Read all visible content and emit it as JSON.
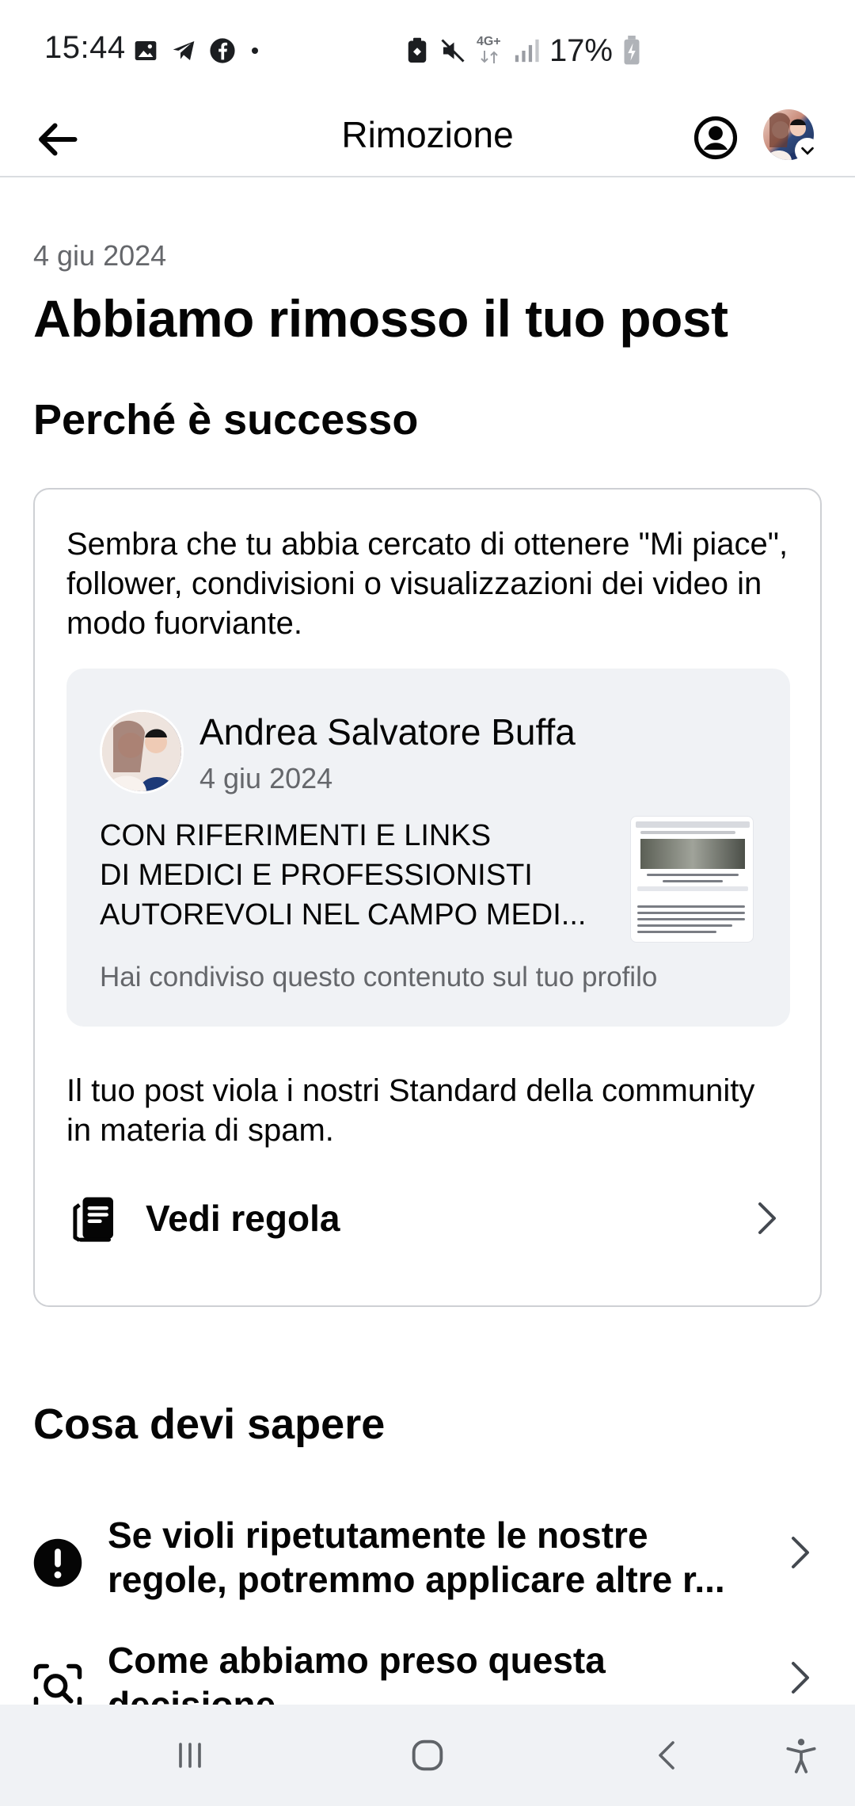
{
  "status_bar": {
    "time": "15:44",
    "left_icons": [
      "image-icon",
      "telegram-icon",
      "facebook-icon",
      "dot-icon"
    ],
    "right_icons": [
      "vpn-icon",
      "mute-icon",
      "network-4g-icon",
      "signal-icon"
    ],
    "network_label": "4G+",
    "battery_percent": "17%"
  },
  "app_bar": {
    "title": "Rimozione"
  },
  "page": {
    "date": "4 giu 2024",
    "headline": "Abbiamo rimosso il tuo post",
    "why_title": "Perché è successo",
    "reason": "Sembra che tu abbia cercato di ottenere \"Mi piace\", follower, condivisioni o visualizzazioni dei video in modo fuorviante.",
    "post": {
      "author": "Andrea Salvatore Buffa",
      "date": "4 giu 2024",
      "text_lines": [
        "CON RIFERIMENTI E LINKS",
        "DI MEDICI E PROFESSIONISTI",
        "AUTOREVOLI NEL CAMPO MEDI..."
      ],
      "shared_note": "Hai condiviso questo contenuto sul tuo profilo"
    },
    "violation": "Il tuo post viola i nostri Standard della community in materia di spam.",
    "rule_link": "Vedi regola",
    "know_title": "Cosa devi sapere",
    "info_items": [
      {
        "lines": [
          "Se violi ripetutamente le nostre",
          "regole, potremmo applicare altre r..."
        ],
        "icon": "alert-icon"
      },
      {
        "lines": [
          "Come abbiamo preso questa",
          "decisione"
        ],
        "icon": "review-search-icon"
      }
    ]
  },
  "colors": {
    "text_primary": "#050505",
    "text_secondary": "#65676b",
    "card_border": "#ced0d4",
    "preview_bg": "#f0f2f5",
    "nav_bg": "#f0f2f5"
  }
}
